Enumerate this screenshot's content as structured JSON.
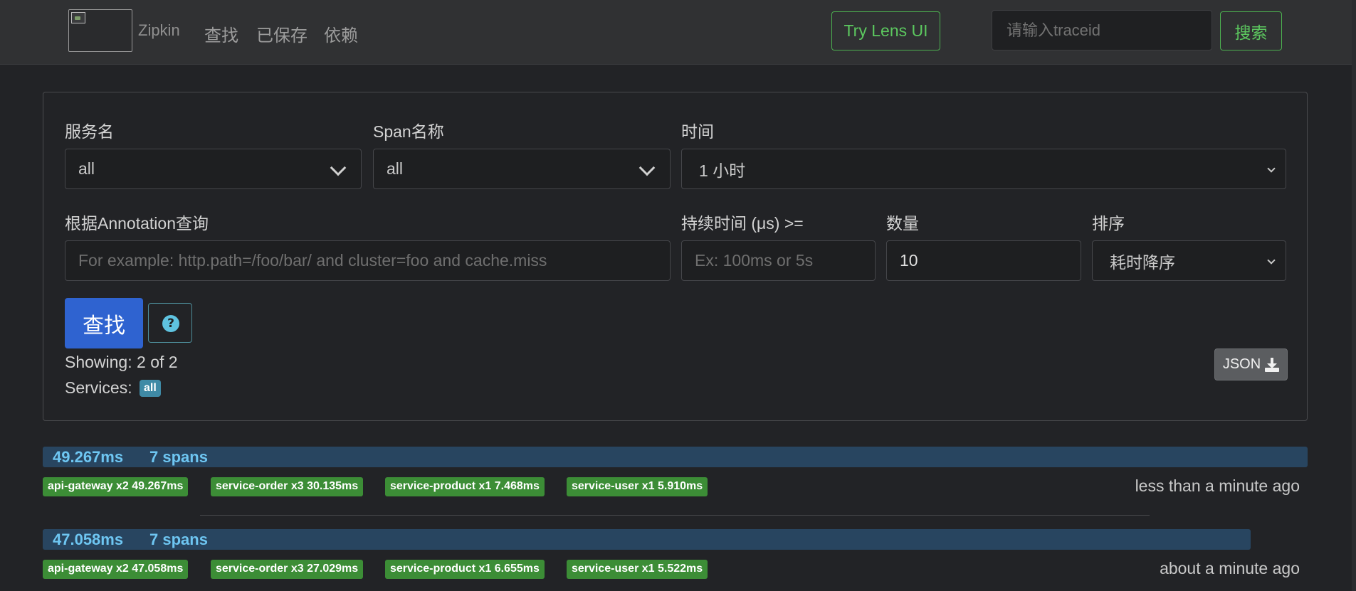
{
  "navbar": {
    "brand": "Zipkin",
    "links": [
      "查找",
      "已保存",
      "依赖"
    ],
    "lens_button": "Try Lens UI",
    "trace_input_placeholder": "请输入traceid",
    "search_button": "搜索"
  },
  "search": {
    "service_label": "服务名",
    "service_value": "all",
    "span_label": "Span名称",
    "span_value": "all",
    "time_label": "时间",
    "time_value": "1 小时",
    "annotation_label": "根据Annotation查询",
    "annotation_placeholder": "For example: http.path=/foo/bar/ and cluster=foo and cache.miss",
    "duration_label": "持续时间 (μs) >=",
    "duration_placeholder": "Ex: 100ms or 5s",
    "limit_label": "数量",
    "limit_value": "10",
    "sort_label": "排序",
    "sort_value": "耗时降序",
    "find_button": "查找",
    "help_glyph": "?",
    "showing_text": "Showing: 2 of 2",
    "services_label": "Services:",
    "services_badge": "all",
    "json_button": "JSON"
  },
  "traces": [
    {
      "duration": "49.267ms",
      "spans": "7 spans",
      "bar_fraction": 1.0,
      "services": [
        "api-gateway x2 49.267ms",
        "service-order x3 30.135ms",
        "service-product x1 7.468ms",
        "service-user x1 5.910ms"
      ],
      "time_ago": "less than a minute ago"
    },
    {
      "duration": "47.058ms",
      "spans": "7 spans",
      "bar_fraction": 0.955,
      "services": [
        "api-gateway x2 47.058ms",
        "service-order x3 27.029ms",
        "service-product x1 6.655ms",
        "service-user x1 5.522ms"
      ],
      "time_ago": "about a minute ago"
    }
  ],
  "colors": {
    "accent_green": "#4caf50",
    "primary_blue": "#2f63d0",
    "service_tag_green": "#3c8d36",
    "trace_bar_blue": "#284560",
    "trace_text_blue": "#6ec6f2"
  }
}
